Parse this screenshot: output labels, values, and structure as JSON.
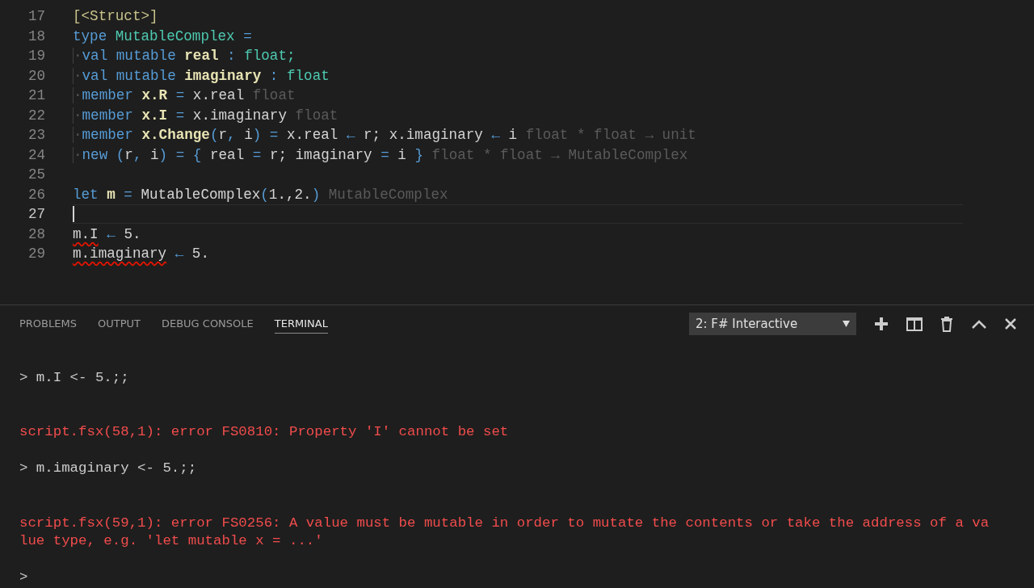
{
  "editor": {
    "lines": [
      {
        "number": "17",
        "current": false,
        "tokens": [
          {
            "kind": "attr",
            "text": "[<Struct>]"
          }
        ]
      },
      {
        "number": "18",
        "current": false,
        "tokens": [
          {
            "kind": "kw",
            "text": "type "
          },
          {
            "kind": "type",
            "text": "MutableComplex"
          },
          {
            "kind": "op",
            "text": " ="
          }
        ]
      },
      {
        "number": "19",
        "current": false,
        "tokens": [
          {
            "kind": "ws",
            "text": "·"
          },
          {
            "kind": "kw",
            "text": "val mutable "
          },
          {
            "kind": "bold",
            "text": "real"
          },
          {
            "kind": "op",
            "text": " : "
          },
          {
            "kind": "type",
            "text": "float;"
          }
        ]
      },
      {
        "number": "20",
        "current": false,
        "tokens": [
          {
            "kind": "ws",
            "text": "·"
          },
          {
            "kind": "kw",
            "text": "val mutable "
          },
          {
            "kind": "bold",
            "text": "imaginary"
          },
          {
            "kind": "op",
            "text": " : "
          },
          {
            "kind": "type",
            "text": "float"
          }
        ]
      },
      {
        "number": "21",
        "current": false,
        "tokens": [
          {
            "kind": "ws",
            "text": "·"
          },
          {
            "kind": "kw",
            "text": "member "
          },
          {
            "kind": "bold",
            "text": "x.R"
          },
          {
            "kind": "op",
            "text": " = "
          },
          {
            "kind": "plain",
            "text": "x.real "
          },
          {
            "kind": "hint",
            "text": "float"
          }
        ]
      },
      {
        "number": "22",
        "current": false,
        "tokens": [
          {
            "kind": "ws",
            "text": "·"
          },
          {
            "kind": "kw",
            "text": "member "
          },
          {
            "kind": "bold",
            "text": "x.I"
          },
          {
            "kind": "op",
            "text": " = "
          },
          {
            "kind": "plain",
            "text": "x.imaginary "
          },
          {
            "kind": "hint",
            "text": "float"
          }
        ]
      },
      {
        "number": "23",
        "current": false,
        "tokens": [
          {
            "kind": "ws",
            "text": "·"
          },
          {
            "kind": "kw",
            "text": "member "
          },
          {
            "kind": "bold",
            "text": "x.Change"
          },
          {
            "kind": "op",
            "text": "("
          },
          {
            "kind": "plain",
            "text": "r"
          },
          {
            "kind": "op",
            "text": ", "
          },
          {
            "kind": "plain",
            "text": "i"
          },
          {
            "kind": "op",
            "text": ") = "
          },
          {
            "kind": "plain",
            "text": "x.real "
          },
          {
            "kind": "op",
            "text": "← "
          },
          {
            "kind": "plain",
            "text": "r; x.imaginary "
          },
          {
            "kind": "op",
            "text": "← "
          },
          {
            "kind": "plain",
            "text": "i "
          },
          {
            "kind": "hint",
            "text": "float * float → unit"
          }
        ]
      },
      {
        "number": "24",
        "current": false,
        "tokens": [
          {
            "kind": "ws",
            "text": "·"
          },
          {
            "kind": "kw",
            "text": "new "
          },
          {
            "kind": "op",
            "text": "("
          },
          {
            "kind": "plain",
            "text": "r"
          },
          {
            "kind": "op",
            "text": ", "
          },
          {
            "kind": "plain",
            "text": "i"
          },
          {
            "kind": "op",
            "text": ") = { "
          },
          {
            "kind": "plain",
            "text": "real "
          },
          {
            "kind": "op",
            "text": "= "
          },
          {
            "kind": "plain",
            "text": "r; imaginary "
          },
          {
            "kind": "op",
            "text": "= "
          },
          {
            "kind": "plain",
            "text": "i "
          },
          {
            "kind": "op",
            "text": "} "
          },
          {
            "kind": "hint",
            "text": "float * float → MutableComplex"
          }
        ]
      },
      {
        "number": "25",
        "current": false
      },
      {
        "number": "26",
        "current": false,
        "tokens": [
          {
            "kind": "kw",
            "text": "let "
          },
          {
            "kind": "bold",
            "text": "m"
          },
          {
            "kind": "op",
            "text": " = "
          },
          {
            "kind": "plain",
            "text": "MutableComplex"
          },
          {
            "kind": "op",
            "text": "("
          },
          {
            "kind": "plain",
            "text": "1.,2."
          },
          {
            "kind": "op",
            "text": ") "
          },
          {
            "kind": "hint",
            "text": "MutableComplex"
          }
        ]
      },
      {
        "number": "27",
        "current": true
      },
      {
        "number": "28",
        "current": false,
        "tokens": [
          {
            "kind": "err",
            "text": "m.I"
          },
          {
            "kind": "op",
            "text": " ← "
          },
          {
            "kind": "plain",
            "text": "5."
          }
        ]
      },
      {
        "number": "29",
        "current": false,
        "tokens": [
          {
            "kind": "err",
            "text": "m.imaginary"
          },
          {
            "kind": "op",
            "text": " ← "
          },
          {
            "kind": "plain",
            "text": "5."
          }
        ]
      }
    ]
  },
  "panel": {
    "tabs": [
      {
        "label": "PROBLEMS",
        "selected": false
      },
      {
        "label": "OUTPUT",
        "selected": false
      },
      {
        "label": "DEBUG CONSOLE",
        "selected": false
      },
      {
        "label": "TERMINAL",
        "selected": true
      }
    ],
    "terminal_select": {
      "value": "2: F# Interactive"
    },
    "terminal": [
      {
        "kind": "input",
        "lines": [
          "> m.I <- 5.;;"
        ]
      },
      {
        "kind": "error",
        "lines": [
          "script.fsx(58,1): error FS0810: Property 'I' cannot be set"
        ]
      },
      {
        "kind": "input",
        "lines": [
          "> m.imaginary <- 5.;;"
        ]
      },
      {
        "kind": "error",
        "lines": [
          "script.fsx(59,1): error FS0256: A value must be mutable in order to mutate the contents or take the address of a va",
          "lue type, e.g. 'let mutable x = ...'"
        ]
      },
      {
        "kind": "input",
        "lines": [
          ">"
        ]
      }
    ]
  }
}
